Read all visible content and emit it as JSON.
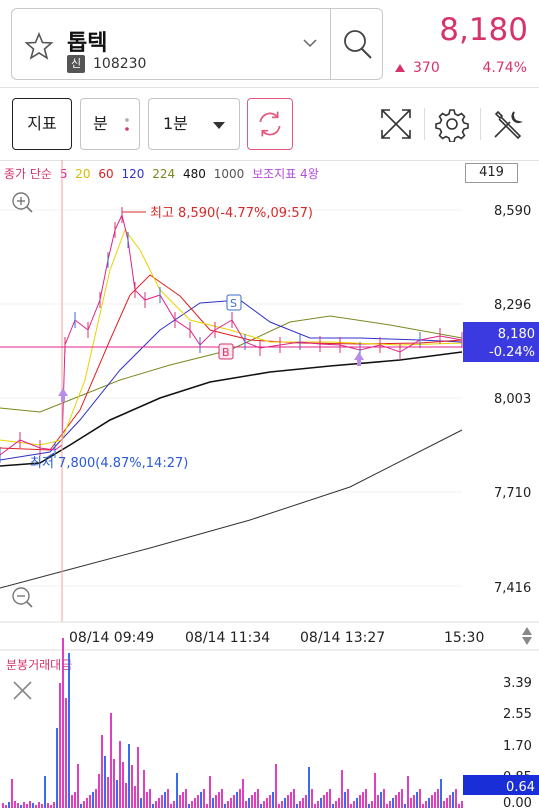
{
  "stock": {
    "name": "톱텍",
    "badge": "신",
    "code": "108230",
    "price": "8,180",
    "change": "370",
    "change_pct": "4.74%"
  },
  "toolbar": {
    "indicator_label": "지표",
    "period_label": "분",
    "interval_label": "1분"
  },
  "legend": {
    "prefix": "종가 단순",
    "ma": [
      {
        "label": "5",
        "color": "#e0218a"
      },
      {
        "label": "20",
        "color": "#e8d200"
      },
      {
        "label": "60",
        "color": "#e02020"
      },
      {
        "label": "120",
        "color": "#3030c8"
      },
      {
        "label": "224",
        "color": "#7a8a20"
      },
      {
        "label": "480",
        "color": "#111111"
      },
      {
        "label": "1000",
        "color": "#555555"
      }
    ],
    "sub_indicator": "보조지표 4왕",
    "count": "419"
  },
  "chart_data": {
    "type": "line",
    "y_ticks": [
      "8,590",
      "8,296",
      "8,003",
      "7,710",
      "7,416"
    ],
    "x_ticks": [
      "08/14 09:49",
      "08/14 11:34",
      "08/14 13:27",
      "15:30"
    ],
    "high_label": "최고 8,590(-4.77%,09:57)",
    "low_label": "최저 7,800(4.87%,14:27)",
    "last_price_label": "8,180",
    "last_pct_label": "-0.24%",
    "markers": [
      "S",
      "B"
    ],
    "ylim": [
      7380,
      8620
    ]
  },
  "volume": {
    "title": "분봉거래대금",
    "y_ticks": [
      "3.39",
      "2.55",
      "1.70",
      "0.85",
      "0.00"
    ],
    "last_value": "0.64"
  },
  "colors": {
    "up": "#d6336c",
    "crosshair": "#e0218a",
    "last_box": "#3a3ae0",
    "vol_bar": "#e040c0",
    "vol_bar_blue": "#3a6cf0"
  }
}
